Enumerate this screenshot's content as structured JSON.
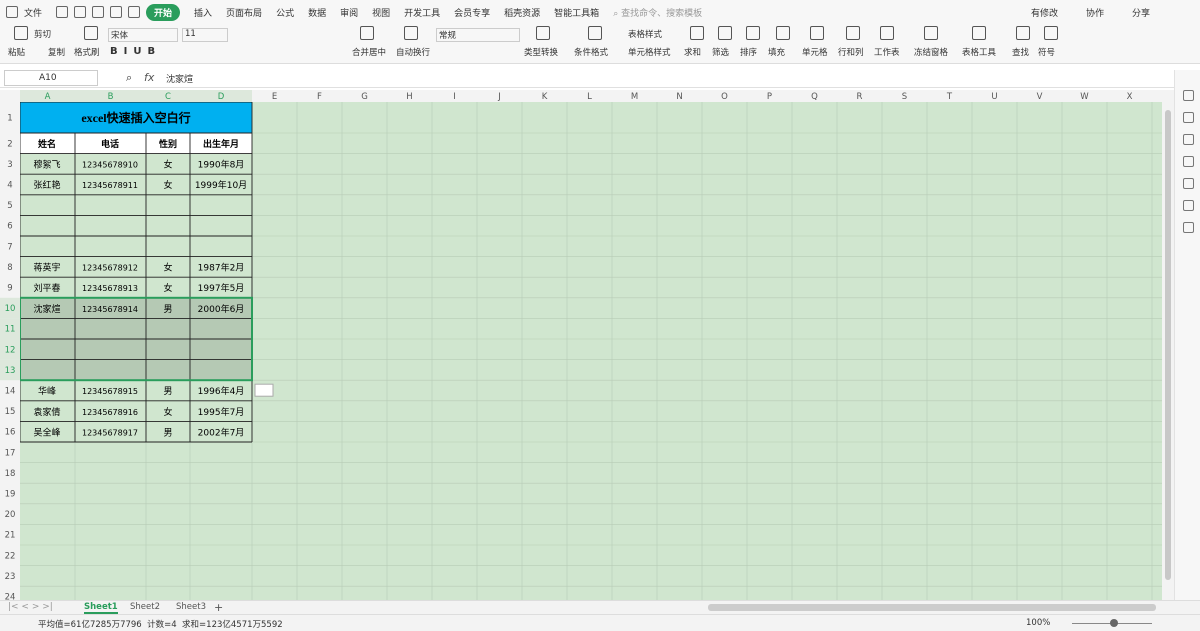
{
  "menu": {
    "items": [
      "文件",
      "开始",
      "插入",
      "页面布局",
      "公式",
      "数据",
      "审阅",
      "视图",
      "开发工具",
      "会员专享",
      "稻壳资源",
      "智能工具箱"
    ],
    "active_index": 1,
    "search_placeholder": "查找命令、搜索模板",
    "right": [
      "有修改",
      "协作",
      "分享"
    ]
  },
  "ribbon": {
    "paste": "粘贴",
    "cut": "剪切",
    "copy": "复制",
    "format_painter": "格式刷",
    "font": "宋体",
    "font_size": "11",
    "merge": "合并居中",
    "wrap": "自动换行",
    "number_format": "常规",
    "convert": "类型转换",
    "cond_format": "条件格式",
    "table_style": "表格样式",
    "cell_style": "单元格样式",
    "sum": "求和",
    "filter": "筛选",
    "sort": "排序",
    "fill": "填充",
    "cell": "单元格",
    "rowcol": "行和列",
    "worksheet": "工作表",
    "freeze": "冻结窗格",
    "table_tools": "表格工具",
    "find": "查找",
    "symbol": "符号"
  },
  "formula_bar": {
    "cell_ref": "A10",
    "fx": "fx",
    "value": "沈家煊"
  },
  "columns": [
    "A",
    "B",
    "C",
    "D",
    "E",
    "F",
    "G",
    "H",
    "I",
    "J",
    "K",
    "L",
    "M",
    "N",
    "O",
    "P",
    "Q",
    "R",
    "S",
    "T",
    "U",
    "V",
    "W",
    "X"
  ],
  "table": {
    "title": "excel快速插入空白行",
    "headers": [
      "姓名",
      "电话",
      "性别",
      "出生年月"
    ],
    "rows": [
      [
        "穆絮飞",
        "12345678910",
        "女",
        "1990年8月"
      ],
      [
        "张红艳",
        "12345678911",
        "女",
        "1999年10月"
      ],
      [
        "",
        "",
        "",
        ""
      ],
      [
        "",
        "",
        "",
        ""
      ],
      [
        "",
        "",
        "",
        ""
      ],
      [
        "蒋英宇",
        "12345678912",
        "女",
        "1987年2月"
      ],
      [
        "刘平春",
        "12345678913",
        "女",
        "1997年5月"
      ],
      [
        "沈家煊",
        "12345678914",
        "男",
        "2000年6月"
      ],
      [
        "",
        "",
        "",
        ""
      ],
      [
        "",
        "",
        "",
        ""
      ],
      [
        "",
        "",
        "",
        ""
      ],
      [
        "华峰",
        "12345678915",
        "男",
        "1996年4月"
      ],
      [
        "袁家倩",
        "12345678916",
        "女",
        "1995年7月"
      ],
      [
        "吴全峰",
        "12345678917",
        "男",
        "2002年7月"
      ]
    ]
  },
  "row_numbers": [
    "1",
    "2",
    "3",
    "4",
    "5",
    "6",
    "7",
    "8",
    "9",
    "10",
    "11",
    "12",
    "13",
    "14",
    "15",
    "16",
    "17",
    "18",
    "19",
    "20",
    "21",
    "22",
    "23",
    "24"
  ],
  "sheets": [
    "Sheet1",
    "Sheet2",
    "Sheet3"
  ],
  "active_sheet": 0,
  "status": {
    "summary": "平均值=61亿7285万7796  计数=4  求和=123亿4571万5592",
    "zoom": "100%"
  },
  "colors": {
    "title_bg": "#00b0f0",
    "grid_bg": "#d0e6cf",
    "accent": "#2a9d5c",
    "selection": "#b5c9b4"
  }
}
